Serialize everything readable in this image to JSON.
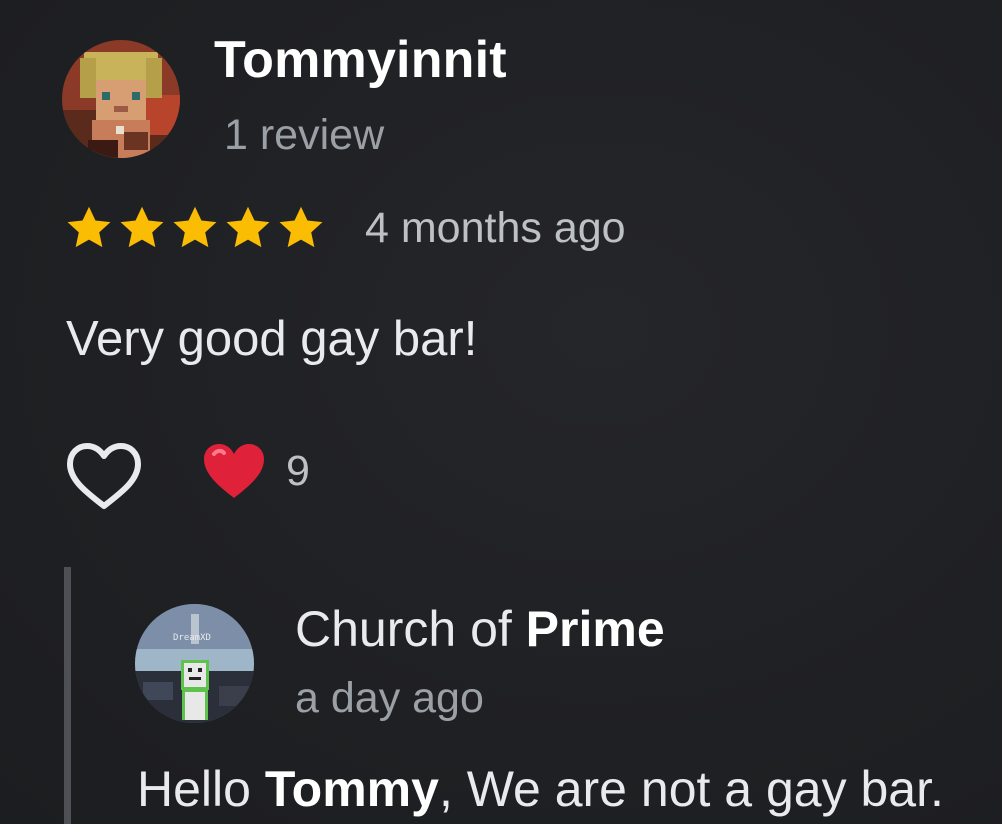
{
  "review": {
    "author": "Tommyinnit",
    "review_count": "1 review",
    "rating": 5,
    "rating_max": 5,
    "star_icon": "star-icon",
    "time": "4 months ago",
    "text": "Very good gay bar!",
    "avatar_icon": "pixel-avatar"
  },
  "reactions": {
    "like_icon": "heart-outline-icon",
    "emoji_icon": "red-heart-emoji",
    "count": "9"
  },
  "reply": {
    "author_prefix": "Church of ",
    "author_bold": "Prime",
    "time": "a day ago",
    "text_prefix": "Hello ",
    "text_bold": "Tommy",
    "text_rest": ", We are not a gay bar.",
    "avatar_icon": "pixel-avatar",
    "avatar_label": "DreamXD"
  },
  "colors": {
    "background": "#202124",
    "star": "#fbbc04",
    "heart_emoji": "#e0213a",
    "reply_bar": "#4e5056",
    "secondary_text": "#9aa0a6"
  }
}
